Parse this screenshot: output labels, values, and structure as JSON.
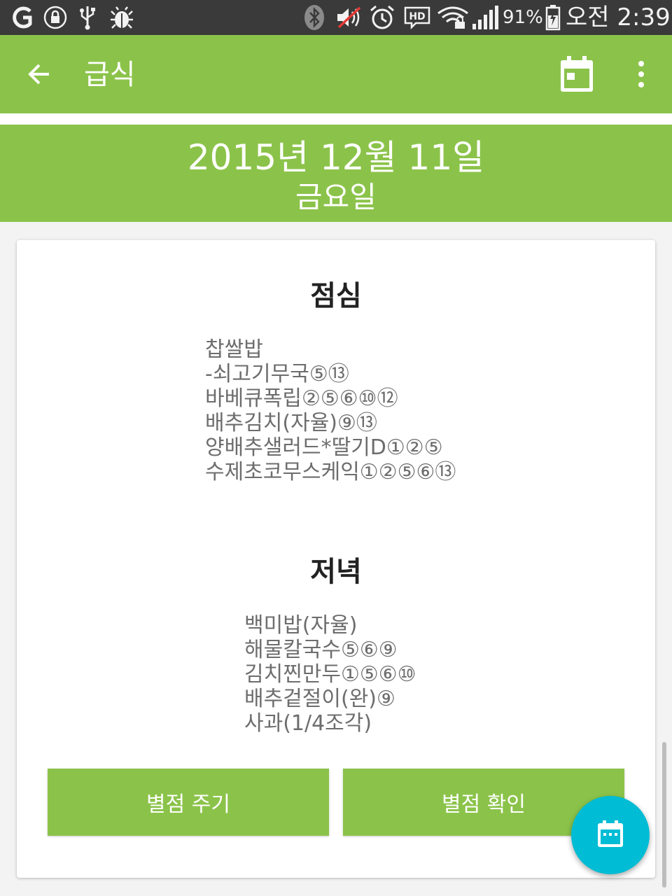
{
  "status_bar": {
    "battery_percent": "91%",
    "time": "오전 2:39",
    "icons": [
      "g-app-icon",
      "lock-icon",
      "usb-icon",
      "bug-icon",
      "bluetooth-icon",
      "mute-icon",
      "alarm-icon",
      "hd-icon",
      "wifi-icon",
      "signal-icon",
      "battery-charging-icon"
    ]
  },
  "app_bar": {
    "title": "급식",
    "color": "#8bc34a"
  },
  "date_banner": {
    "date": "2015년 12월 11일",
    "weekday": "금요일"
  },
  "meals": {
    "lunch": {
      "title": "점심",
      "items": [
        "찹쌀밥",
        "-쇠고기무국⑤⑬",
        "바베큐폭립②⑤⑥⑩⑫",
        "배추김치(자율)⑨⑬",
        "양배추샐러드*딸기D①②⑤",
        "수제초코무스케익①②⑤⑥⑬"
      ]
    },
    "dinner": {
      "title": "저녁",
      "items": [
        "백미밥(자율)",
        "해물칼국수⑤⑥⑨",
        "김치찐만두①⑤⑥⑩",
        "배추겉절이(완)⑨",
        "사과(1/4조각)"
      ]
    }
  },
  "buttons": {
    "rate": "별점 주기",
    "check_rating": "별점 확인"
  },
  "fab": {
    "icon": "calendar-icon",
    "color": "#00bcd4"
  }
}
